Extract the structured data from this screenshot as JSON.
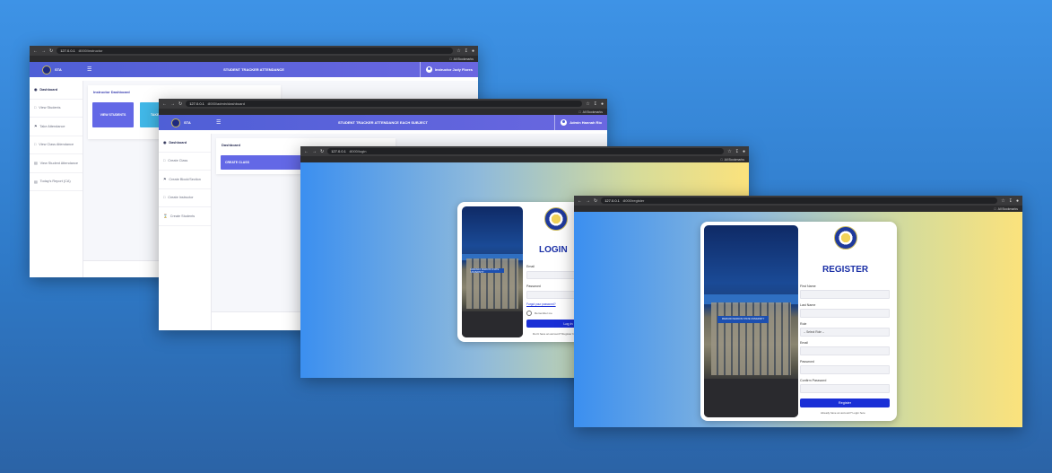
{
  "colors": {
    "nav": "#5a63dc",
    "tile_purple": "#6368e6",
    "tile_cyan": "#41b8e8",
    "button": "#1a2fd6"
  },
  "win1": {
    "url_host": "127.0.0.1",
    "url_path": ":8000/instructor",
    "bookmarks": "All Bookmarks",
    "brand": "STA",
    "title": "STUDENT TRACKER ATTENDANCE",
    "user": "Instructor Judy Flores",
    "sidebar": [
      "Dashboard",
      "View Students",
      "Take Attendance",
      "View Class Attendance",
      "View Student Attendance",
      "Today's Report (CA)"
    ],
    "card_title": "Instructor Dashboard",
    "tile1": "VIEW STUDENTS",
    "tile2": "TAKE ATTE..."
  },
  "win2": {
    "url_host": "127.0.0.1",
    "url_path": ":8000/admin/dashboard",
    "bookmarks": "All Bookmarks",
    "brand": "STA",
    "title": "STUDENT TRACKER ATTENDANCE EACH SUBJECT",
    "user": "Admin Hannah Rio",
    "sidebar": [
      "Dashboard",
      "Create Class",
      "Create Block/Section",
      "Create Instructor",
      "Create Students"
    ],
    "card_title": "Dashboard",
    "tile1": "CREATE CLASS"
  },
  "win3": {
    "url_host": "127.0.0.1",
    "url_path": ":8000/login",
    "bookmarks": "All Bookmarks",
    "heading": "LOGIN",
    "email_label": "Email",
    "password_label": "Password",
    "forgot": "Forgot your password?",
    "remember": "Remember me",
    "button": "Log in",
    "register_prompt": "Don't have an account? Register here",
    "sign": "MARIANO MARCOS STATE UNIVERSITY"
  },
  "win4": {
    "url_host": "127.0.0.1",
    "url_path": ":8000/register",
    "bookmarks": "All Bookmarks",
    "heading": "REGISTER",
    "first_name": "First Name",
    "last_name": "Last Name",
    "role": "Role",
    "role_select": "-- Select Role --",
    "email": "Email",
    "password": "Password",
    "confirm": "Confirm Password",
    "button": "Register",
    "login_prompt": "Already have an account? Login here",
    "sign": "MARIANO MARCOS STATE UNIVERSITY"
  }
}
